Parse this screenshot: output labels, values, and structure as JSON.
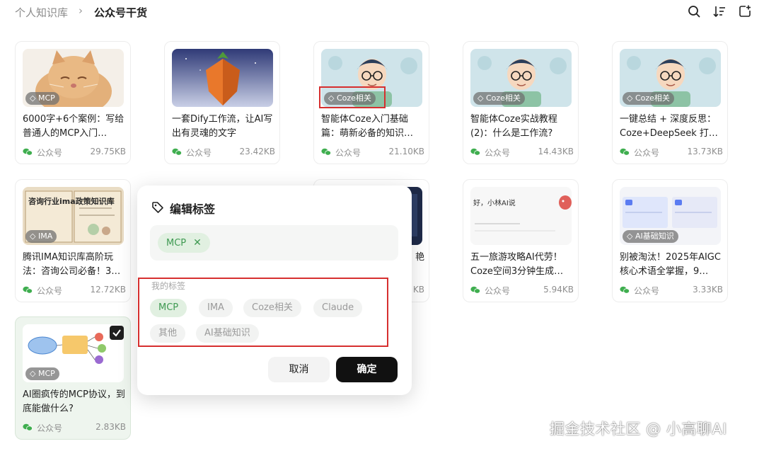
{
  "breadcrumb": {
    "root": "个人知识库",
    "separator": "›",
    "current": "公众号干货"
  },
  "toolbar": {
    "icons": [
      "search-icon",
      "sort-icon",
      "add-file-icon"
    ]
  },
  "cards": [
    {
      "tag": "MCP",
      "title": "6000字+6个案例：写给普通人的MCP入门…",
      "source": "公众号",
      "size": "29.75KB",
      "thumb": "cat-photo"
    },
    {
      "tag": "",
      "title": "一套Dify工作流，让AI写出有灵魂的文字",
      "source": "公众号",
      "size": "23.42KB",
      "thumb": "carrot-illustration"
    },
    {
      "tag": "Coze相关",
      "title": "智能体Coze入门基础篇：萌新必备的知识…",
      "source": "公众号",
      "size": "21.10KB",
      "thumb": "boy-illustration"
    },
    {
      "tag": "Coze相关",
      "title": "智能体Coze实战教程(2)：什么是工作流?",
      "source": "公众号",
      "size": "14.43KB",
      "thumb": "boy-illustration"
    },
    {
      "tag": "Coze相关",
      "title": "一键总结 + 深度反思：Coze+DeepSeek 打…",
      "source": "公众号",
      "size": "13.73KB",
      "thumb": "boy-illustration"
    },
    {
      "tag": "IMA",
      "title": "腾讯IMA知识库高阶玩法：咨询公司必备！3…",
      "source": "公众号",
      "size": "12.72KB",
      "thumb": "book-illustration",
      "thumb_text": "咨询行业ima政策知识库"
    },
    {
      "tag": "",
      "title": "艳",
      "source": "",
      "size": "KB",
      "thumb": "dark-screenshot"
    },
    {
      "tag": "",
      "title": "五一旅游攻略AI代劳！Coze空间3分钟生成…",
      "source": "公众号",
      "size": "5.94KB",
      "thumb": "chat-screenshot",
      "thumb_text": "好，小林AI说"
    },
    {
      "tag": "AI基础知识",
      "title": "别被淘汰！2025年AIGC核心术语全掌握，9…",
      "source": "公众号",
      "size": "3.33KB",
      "thumb": "slides-screenshot"
    },
    {
      "tag": "MCP",
      "title": "AI圈疯传的MCP协议，到底能做什么?",
      "source": "公众号",
      "size": "2.83KB",
      "thumb": "mindmap",
      "selected": true
    }
  ],
  "modal": {
    "title": "编辑标签",
    "selected_tags": [
      "MCP"
    ],
    "my_tags_label": "我的标签",
    "tags": [
      {
        "label": "MCP",
        "active": true
      },
      {
        "label": "IMA",
        "active": false
      },
      {
        "label": "Coze相关",
        "active": false
      },
      {
        "label": "Claude",
        "active": false
      },
      {
        "label": "其他",
        "active": false
      },
      {
        "label": "AI基础知识",
        "active": false
      }
    ],
    "cancel_label": "取消",
    "confirm_label": "确定"
  },
  "watermark": "掘金技术社区 @ 小高聊AI",
  "colors": {
    "accent_green": "#3f9a52",
    "chip_green_bg": "#e1f0e1",
    "highlight_red": "#d62f2f",
    "primary_button": "#111111"
  }
}
